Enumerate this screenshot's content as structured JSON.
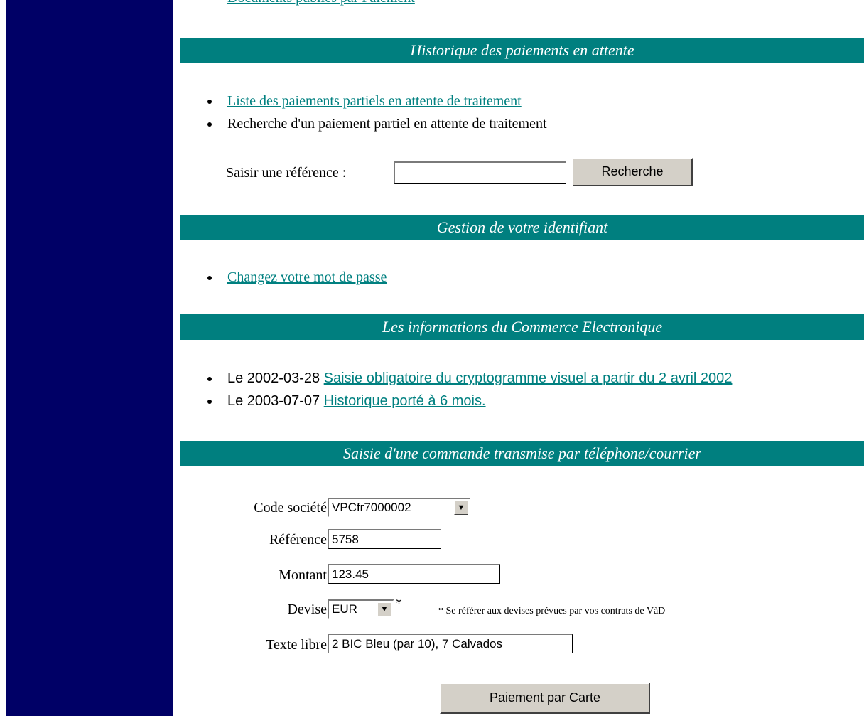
{
  "top_link_cut": "Documents publiés par Paiement",
  "sections": {
    "pending_history": {
      "title": "Historique des paiements en attente",
      "items": {
        "list_link": "Liste des paiements partiels en attente de traitement",
        "search_text": "Recherche d'un paiement partiel en attente de traitement"
      },
      "search": {
        "label": "Saisir une référence :",
        "input_value": "",
        "button_label": "Recherche"
      }
    },
    "identifier": {
      "title": "Gestion de votre identifiant",
      "items": {
        "change_password_link": "Changez votre mot de passe"
      }
    },
    "news": {
      "title": "Les informations du Commerce Electronique",
      "items": [
        {
          "prefix": "Le 2002-03-28",
          "link": "Saisie obligatoire du cryptogramme visuel a partir du 2 avril 2002"
        },
        {
          "prefix": "Le 2003-07-07",
          "link": "Historique porté à 6 mois."
        }
      ]
    },
    "phone_order": {
      "title": "Saisie d'une commande transmise par téléphone/courrier",
      "fields": {
        "company_label": "Code société",
        "company_value": "VPCfr7000002",
        "reference_label": "Référence",
        "reference_value": "5758",
        "amount_label": "Montant",
        "amount_value": "123.45",
        "currency_label": "Devise",
        "currency_value": "EUR",
        "currency_star": "*",
        "currency_note": "* Se référer aux devises prévues par vos contrats de VàD",
        "free_text_label": "Texte libre",
        "free_text_value": "2 BIC Bleu (par 10), 7 Calvados"
      },
      "submit_label": "Paiement par Carte"
    }
  }
}
